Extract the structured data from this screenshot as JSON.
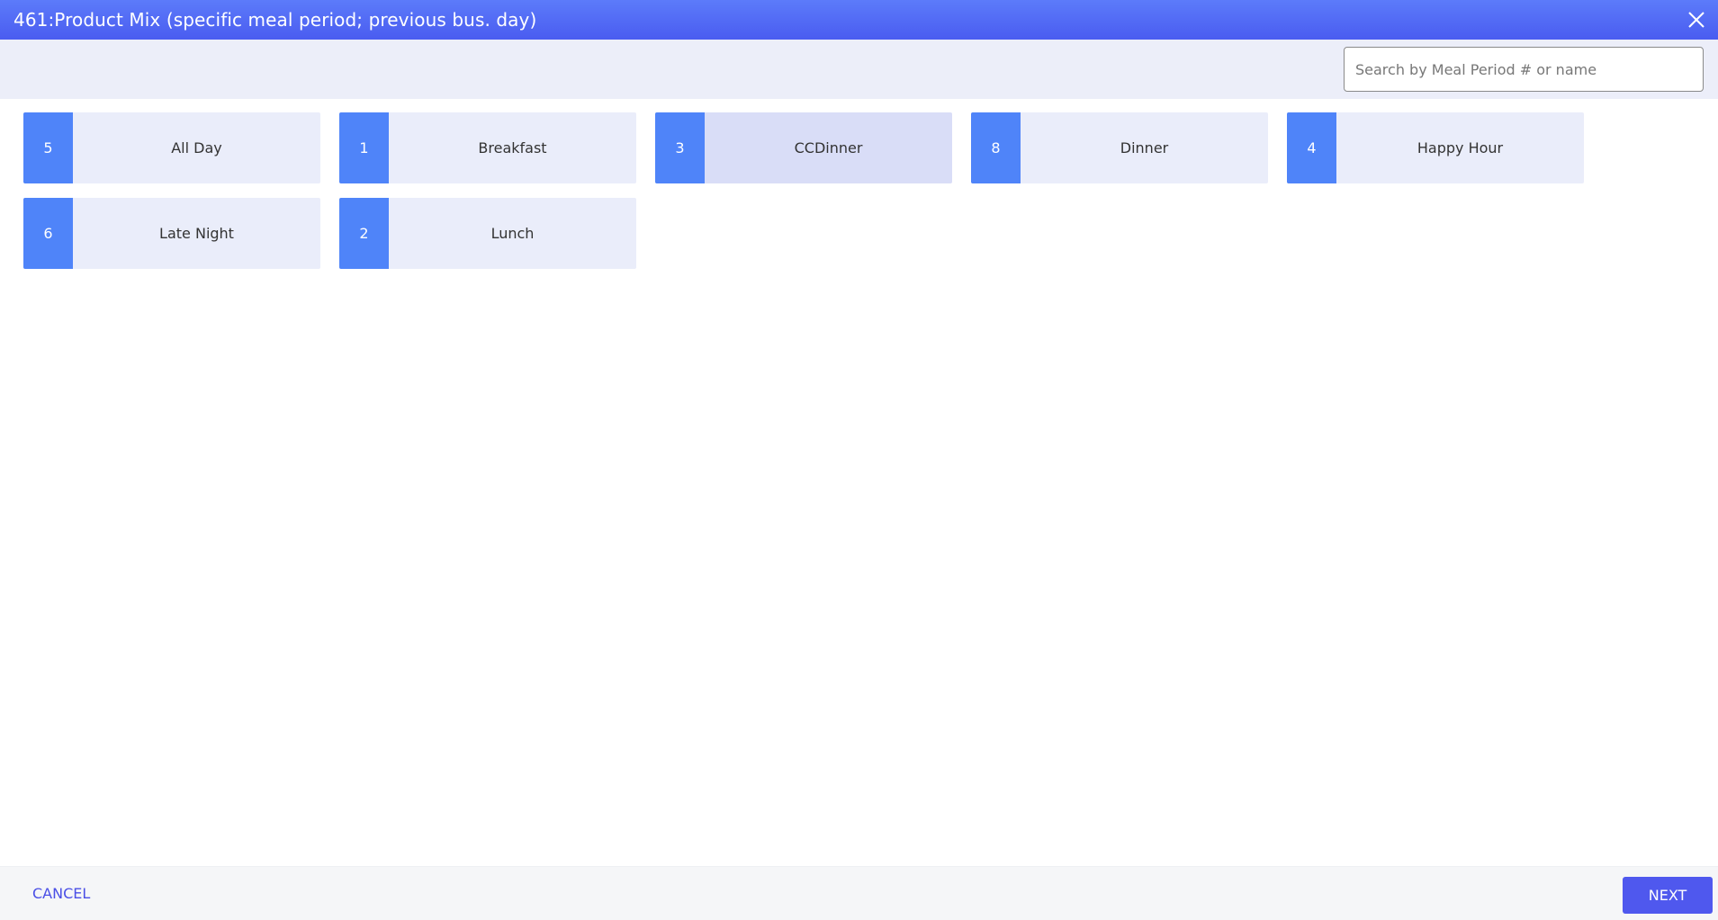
{
  "dialog": {
    "title": "461:Product Mix (specific meal period; previous bus. day)",
    "close_icon": "close-icon"
  },
  "search": {
    "placeholder": "Search by Meal Period # or name",
    "value": ""
  },
  "meal_periods": [
    {
      "number": "5",
      "name": "All Day",
      "selected": false
    },
    {
      "number": "1",
      "name": "Breakfast",
      "selected": false
    },
    {
      "number": "3",
      "name": "CCDinner",
      "selected": true
    },
    {
      "number": "8",
      "name": "Dinner",
      "selected": false
    },
    {
      "number": "4",
      "name": "Happy Hour",
      "selected": false
    },
    {
      "number": "6",
      "name": "Late Night",
      "selected": false
    },
    {
      "number": "2",
      "name": "Lunch",
      "selected": false
    }
  ],
  "footer": {
    "cancel_label": "CANCEL",
    "next_label": "NEXT"
  },
  "colors": {
    "header_gradient_top": "#5c7bfa",
    "header_gradient_bottom": "#4a5cf0",
    "tile_number_bg": "#4f84f9",
    "tile_bg": "#eaedfa",
    "tile_selected_bg": "#d9ddf7",
    "primary_button": "#4f58ee"
  }
}
